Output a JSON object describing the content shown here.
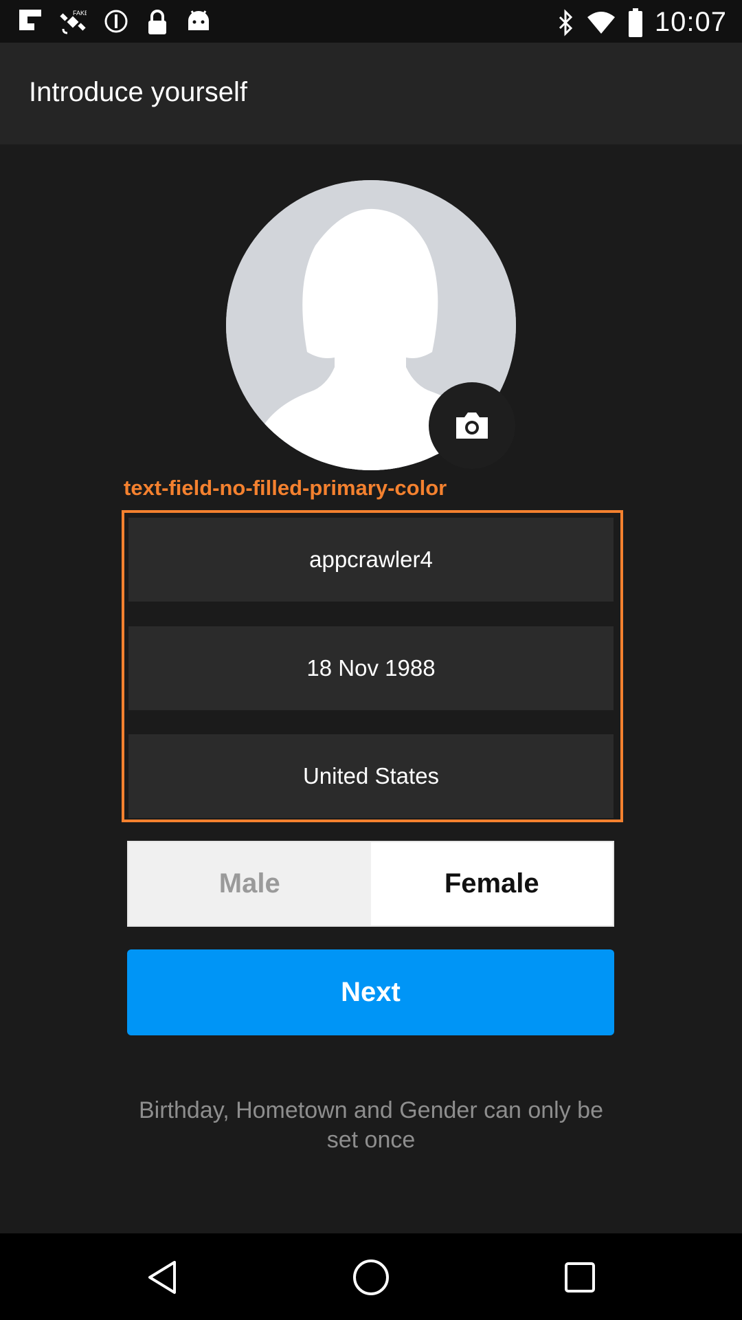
{
  "status_bar": {
    "time": "10:07",
    "left_icons": [
      "flipboard-icon",
      "satellite-fake-gps-icon",
      "alert-circle-icon",
      "lock-icon",
      "android-icon"
    ],
    "right_icons": [
      "bluetooth-icon",
      "wifi-icon",
      "battery-icon"
    ]
  },
  "app_bar": {
    "title": "Introduce yourself"
  },
  "profile": {
    "avatar_icon": "default-avatar-icon",
    "camera_icon": "camera-icon"
  },
  "annotation": {
    "label": "text-field-no-filled-primary-color",
    "color": "#f4812f"
  },
  "fields": {
    "username": "appcrawler4",
    "birthday": "18 Nov 1988",
    "hometown": "United States"
  },
  "gender": {
    "male_label": "Male",
    "female_label": "Female",
    "selected": "Female"
  },
  "next_button": {
    "label": "Next",
    "color": "#0095f6"
  },
  "notice": {
    "text": "Birthday, Hometown and Gender can only be set once"
  },
  "nav_bar": {
    "icons": [
      "back-icon",
      "home-icon",
      "recents-icon"
    ]
  }
}
